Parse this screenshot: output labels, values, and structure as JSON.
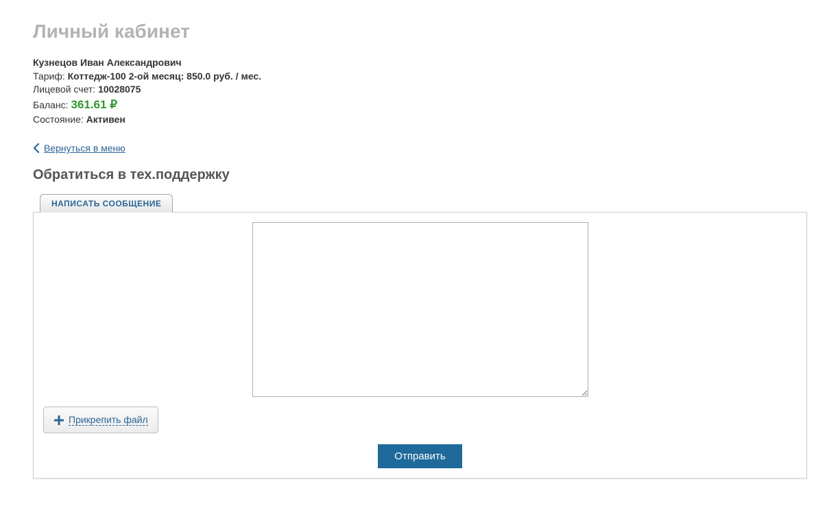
{
  "page": {
    "title": "Личный кабинет"
  },
  "account": {
    "name": "Кузнецов Иван Александрович",
    "tariff_label": "Тариф: ",
    "tariff_value": "Коттедж-100 2-ой месяц: 850.0 руб. / мес.",
    "account_label": "Лицевой счет: ",
    "account_value": "10028075",
    "balance_label": "Баланс: ",
    "balance_value": "361.61 ",
    "balance_currency": "₽",
    "status_label": "Состояние: ",
    "status_value": "Активен"
  },
  "nav": {
    "back_label": "Вернуться в меню"
  },
  "support": {
    "title": "Обратиться в тех.поддержку",
    "tab_label": "НАПИСАТЬ СООБЩЕНИЕ",
    "message_value": "",
    "attach_label": "Прикрепить файл",
    "submit_label": "Отправить"
  }
}
